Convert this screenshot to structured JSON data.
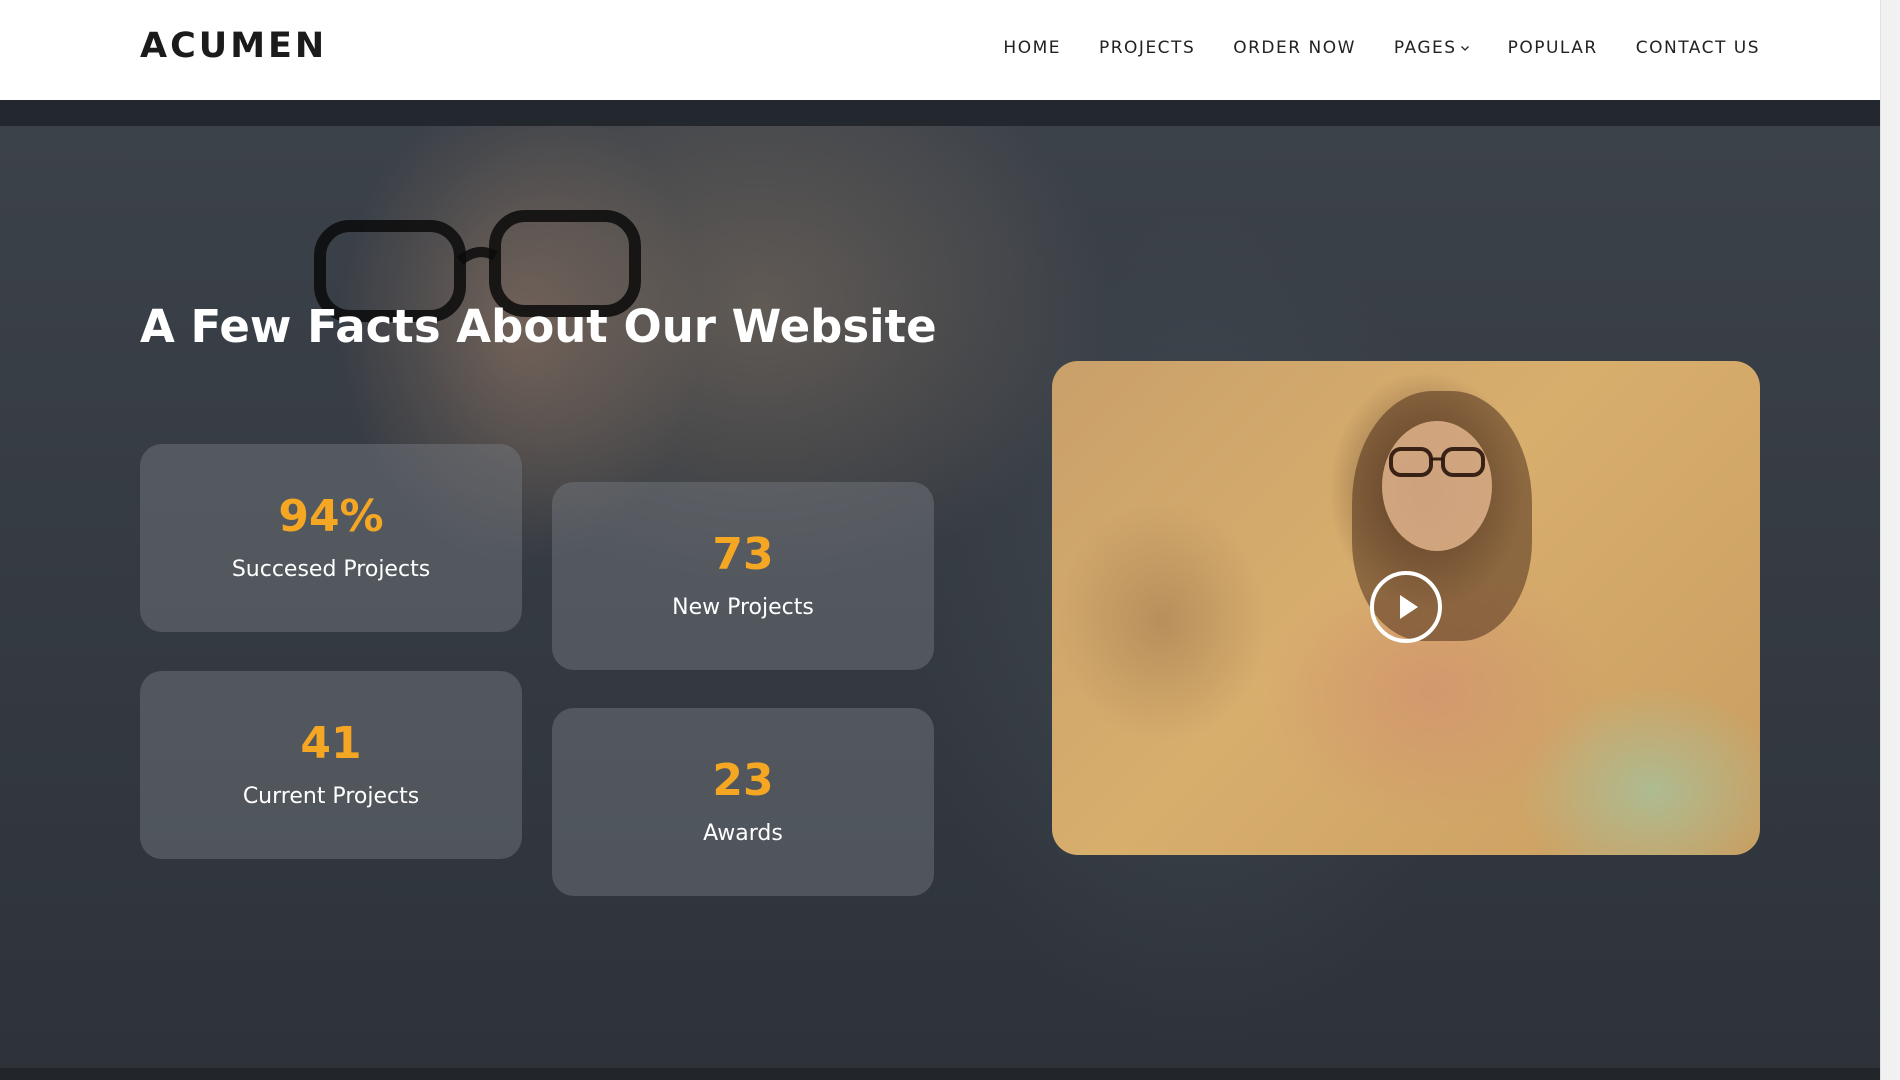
{
  "header": {
    "logo": "ACUMEN",
    "nav": [
      {
        "label": "HOME"
      },
      {
        "label": "PROJECTS"
      },
      {
        "label": "ORDER NOW"
      },
      {
        "label": "PAGES",
        "has_dropdown": true
      },
      {
        "label": "POPULAR"
      },
      {
        "label": "CONTACT US"
      }
    ]
  },
  "facts": {
    "title": "A Few Facts About Our Website",
    "items": [
      {
        "value": "94%",
        "label": "Succesed Projects"
      },
      {
        "value": "73",
        "label": "New Projects"
      },
      {
        "value": "41",
        "label": "Current Projects"
      },
      {
        "value": "23",
        "label": "Awards"
      }
    ]
  },
  "video": {
    "play_icon": "play-icon"
  },
  "colors": {
    "accent": "#f5a623",
    "card_bg": "#787c82",
    "header_bg": "#ffffff"
  }
}
